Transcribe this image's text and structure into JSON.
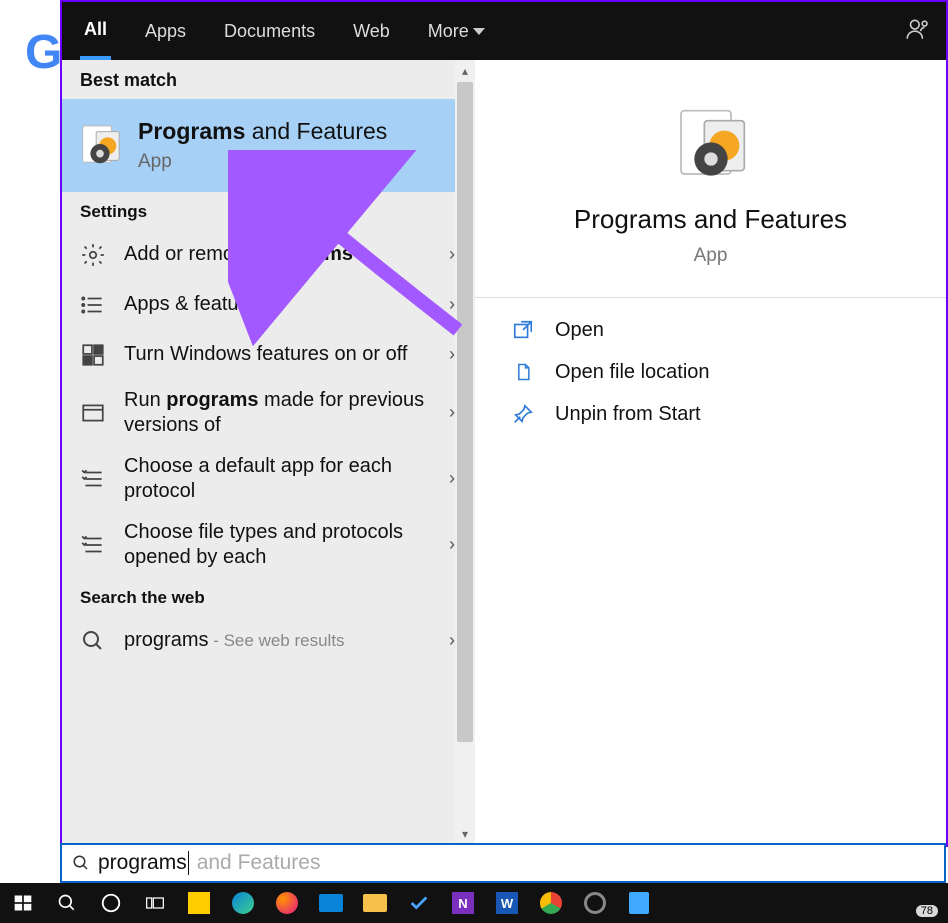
{
  "tabs": {
    "all": "All",
    "apps": "Apps",
    "documents": "Documents",
    "web": "Web",
    "more": "More"
  },
  "sections": {
    "best_match": "Best match",
    "settings": "Settings",
    "web": "Search the web"
  },
  "best_match": {
    "title_bold": "Programs",
    "title_rest": " and Features",
    "sub": "App"
  },
  "settings_items": [
    {
      "pre": "Add or remove ",
      "bold": "programs",
      "post": ""
    },
    {
      "pre": "Apps & features",
      "bold": "",
      "post": ""
    },
    {
      "pre": "Turn Windows features on or off",
      "bold": "",
      "post": ""
    },
    {
      "pre": "Run ",
      "bold": "programs",
      "post": " made for previous versions of"
    },
    {
      "pre": "Choose a default app for each protocol",
      "bold": "",
      "post": ""
    },
    {
      "pre": "Choose file types and protocols opened by each",
      "bold": "",
      "post": ""
    }
  ],
  "web_item": {
    "text": "programs",
    "suffix": " - See web results"
  },
  "details": {
    "title": "Programs and Features",
    "sub": "App",
    "actions": {
      "open": "Open",
      "loc": "Open file location",
      "unpin": "Unpin from Start"
    }
  },
  "search": {
    "typed": "programs",
    "ghost": " and Features"
  },
  "taskbar_badge": "78"
}
